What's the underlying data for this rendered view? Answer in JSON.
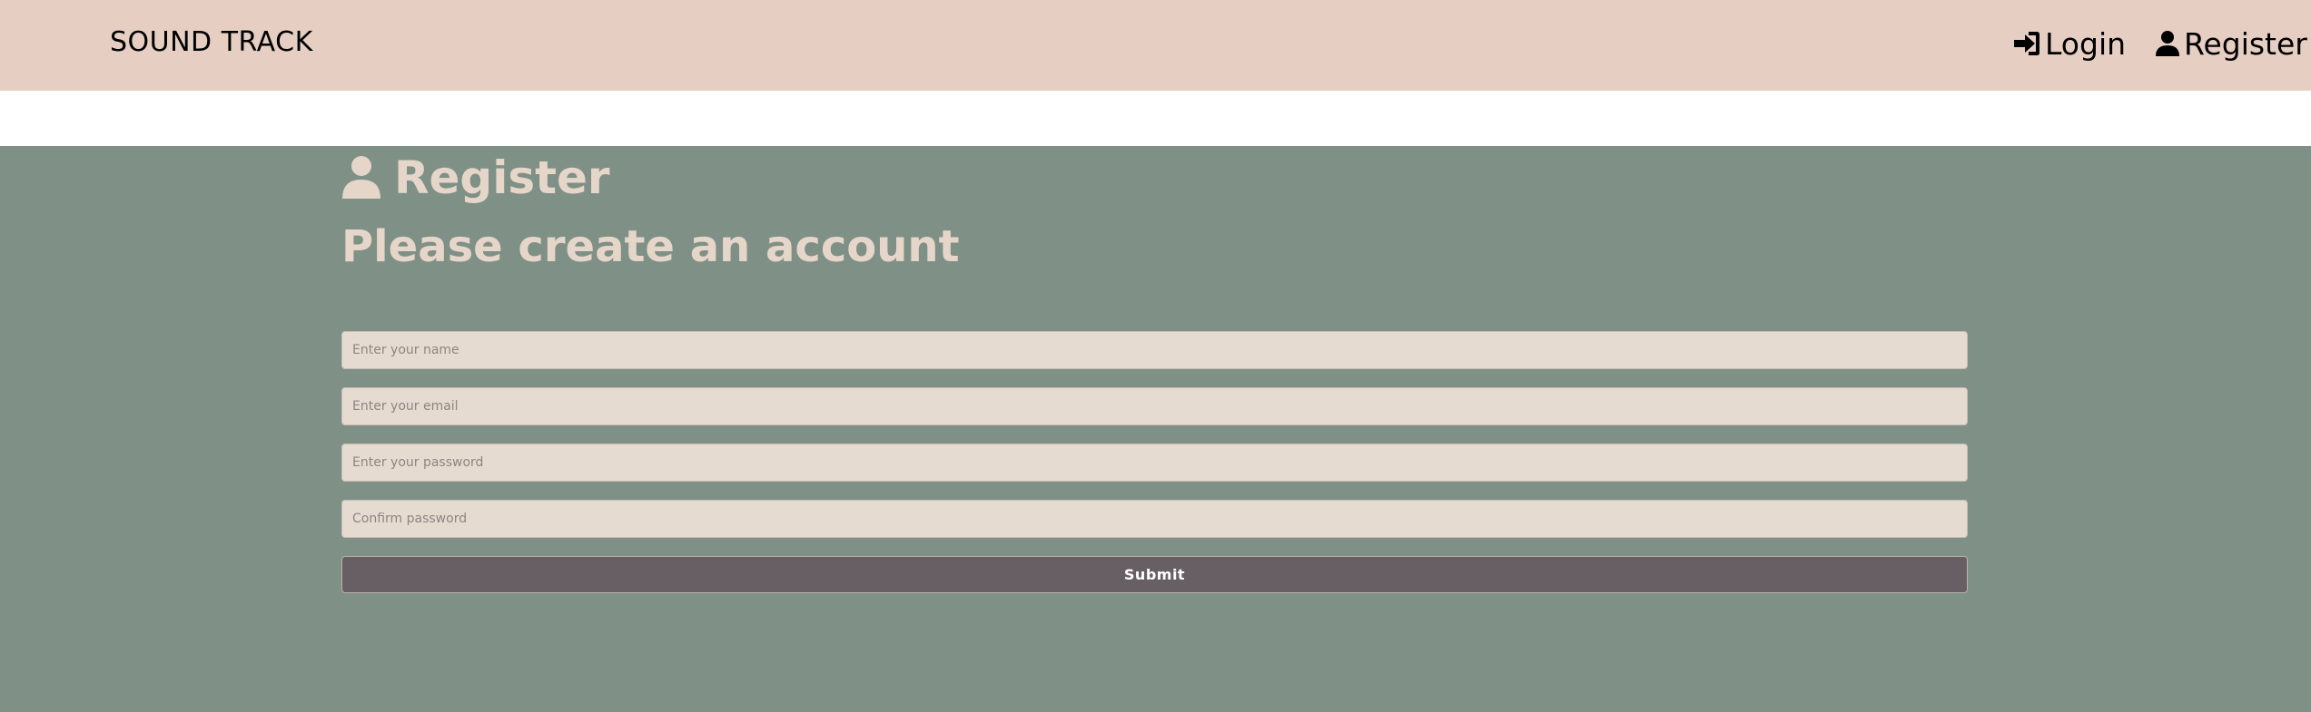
{
  "navbar": {
    "brand": "SOUND TRACK",
    "links": [
      {
        "label": "Login",
        "icon": "sign-in-icon"
      },
      {
        "label": "Register",
        "icon": "user-icon"
      }
    ]
  },
  "page": {
    "heading": "Register",
    "subheading": "Please create an account"
  },
  "form": {
    "name_placeholder": "Enter your name",
    "email_placeholder": "Enter your email",
    "password_placeholder": "Enter your password",
    "confirm_placeholder": "Confirm password",
    "submit_label": "Submit"
  },
  "colors": {
    "navbar_bg": "#e6cfc2",
    "main_bg": "#7f9186",
    "heading_text": "#e6d6ca",
    "input_bg": "#e6dbd1",
    "submit_bg": "#675f63"
  }
}
